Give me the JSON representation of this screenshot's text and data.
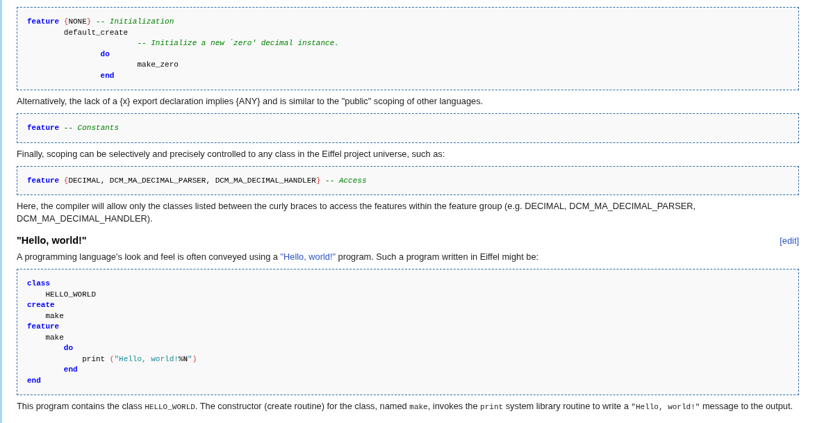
{
  "blocks": [
    {
      "kind": "code",
      "lines": [
        [
          {
            "kind": "keyword",
            "text": "feature"
          },
          {
            "kind": "brace",
            "text": " {"
          },
          {
            "kind": "plain",
            "text": "NONE"
          },
          {
            "kind": "brace",
            "text": "}"
          },
          {
            "kind": "comment",
            "text": " -- Initialization"
          }
        ],
        [
          {
            "kind": "plain",
            "text": "        default_create"
          }
        ],
        [
          {
            "kind": "comment",
            "text": "                        -- Initialize a new `zero' decimal instance."
          }
        ],
        [
          {
            "kind": "keyword",
            "text": "                do"
          }
        ],
        [
          {
            "kind": "plain",
            "text": "                        make_zero"
          }
        ],
        [
          {
            "kind": "keyword",
            "text": "                end"
          }
        ]
      ]
    },
    {
      "kind": "paragraph",
      "segments": [
        {
          "kind": "text",
          "text": "Alternatively, the lack of a {x} export declaration implies {ANY} and is similar to the \"public\" scoping of other languages."
        }
      ]
    },
    {
      "kind": "code",
      "lines": [
        [
          {
            "kind": "keyword",
            "text": "feature"
          },
          {
            "kind": "comment",
            "text": " -- Constants"
          }
        ]
      ]
    },
    {
      "kind": "paragraph",
      "segments": [
        {
          "kind": "text",
          "text": "Finally, scoping can be selectively and precisely controlled to any class in the Eiffel project universe, such as:"
        }
      ]
    },
    {
      "kind": "code",
      "lines": [
        [
          {
            "kind": "keyword",
            "text": "feature"
          },
          {
            "kind": "brace",
            "text": " {"
          },
          {
            "kind": "plain",
            "text": "DECIMAL, DCM_MA_DECIMAL_PARSER, DCM_MA_DECIMAL_HANDLER"
          },
          {
            "kind": "brace",
            "text": "}"
          },
          {
            "kind": "comment",
            "text": " -- Access"
          }
        ]
      ]
    },
    {
      "kind": "paragraph",
      "segments": [
        {
          "kind": "text",
          "text": "Here, the compiler will allow only the classes listed between the curly braces to access the features within the feature group (e.g. DECIMAL, DCM_MA_DECIMAL_PARSER, DCM_MA_DECIMAL_HANDLER)."
        }
      ]
    },
    {
      "kind": "heading",
      "text": "\"Hello, world!\"",
      "edit": "[edit]"
    },
    {
      "kind": "paragraph",
      "segments": [
        {
          "kind": "text",
          "text": "A programming language's look and feel is often conveyed using a "
        },
        {
          "kind": "link",
          "text": "\"Hello, world!\""
        },
        {
          "kind": "text",
          "text": " program. Such a program written in Eiffel might be:"
        }
      ]
    },
    {
      "kind": "code",
      "lines": [
        [
          {
            "kind": "keyword",
            "text": "class"
          }
        ],
        [
          {
            "kind": "plain",
            "text": "    HELLO_WORLD"
          }
        ],
        [
          {
            "kind": "keyword",
            "text": "create"
          }
        ],
        [
          {
            "kind": "plain",
            "text": "    make"
          }
        ],
        [
          {
            "kind": "keyword",
            "text": "feature"
          }
        ],
        [
          {
            "kind": "plain",
            "text": "    make"
          }
        ],
        [
          {
            "kind": "keyword",
            "text": "        do"
          }
        ],
        [
          {
            "kind": "plain",
            "text": "            print "
          },
          {
            "kind": "brace",
            "text": "("
          },
          {
            "kind": "string",
            "text": "\"Hello, world!"
          },
          {
            "kind": "escape",
            "text": "%N"
          },
          {
            "kind": "string",
            "text": "\""
          },
          {
            "kind": "brace",
            "text": ")"
          }
        ],
        [
          {
            "kind": "keyword",
            "text": "        end"
          }
        ],
        [
          {
            "kind": "keyword",
            "text": "end"
          }
        ]
      ]
    },
    {
      "kind": "paragraph",
      "segments": [
        {
          "kind": "text",
          "text": "This program contains the class "
        },
        {
          "kind": "code",
          "text": "HELLO_WORLD"
        },
        {
          "kind": "text",
          "text": ". The constructor (create routine) for the class, named "
        },
        {
          "kind": "code",
          "text": "make"
        },
        {
          "kind": "text",
          "text": ", invokes the "
        },
        {
          "kind": "code",
          "text": "print"
        },
        {
          "kind": "text",
          "text": " system library routine to write a "
        },
        {
          "kind": "code",
          "text": "\"Hello, world!\""
        },
        {
          "kind": "text",
          "text": " message to the output."
        }
      ]
    }
  ]
}
